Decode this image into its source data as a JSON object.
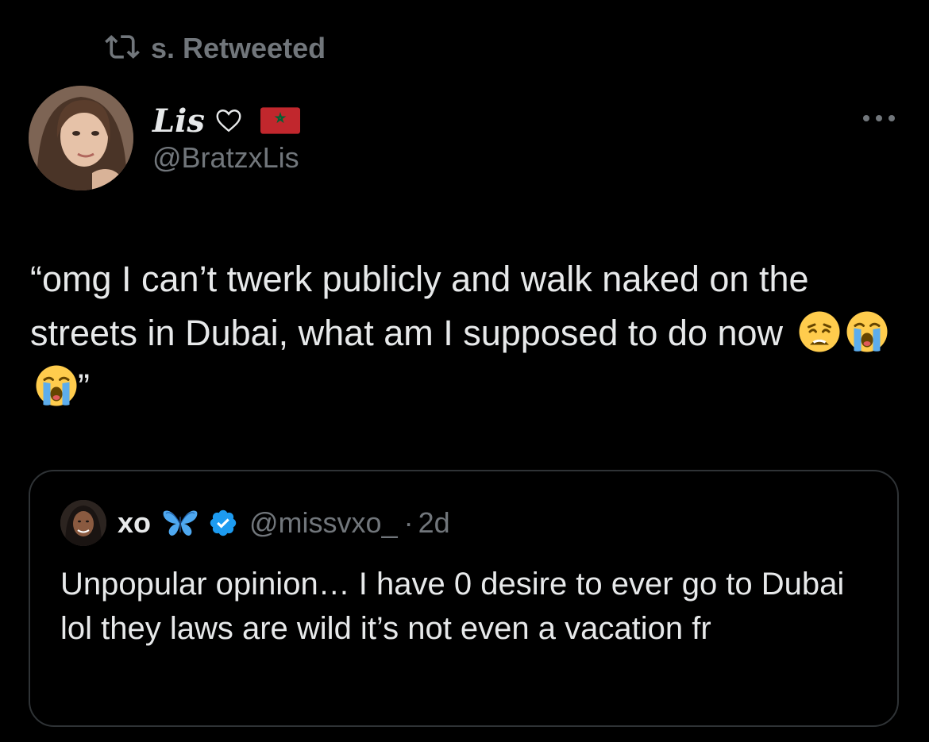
{
  "retweet": {
    "label": "s. Retweeted",
    "icon": "retweet-icon"
  },
  "author": {
    "display_name": "Lis",
    "handle": "@BratzxLis",
    "name_icons": [
      "heart-outline-icon",
      "morocco-flag-icon"
    ],
    "avatar": "avatar"
  },
  "more_icon": "more-icon",
  "tweet": {
    "text": "“omg I can’t twerk publicly and walk naked on the streets in Dubai, what am I supposed to do now",
    "emojis": [
      "weary-face-emoji",
      "loudly-crying-face-emoji",
      "loudly-crying-face-emoji"
    ],
    "closing_quote": "”"
  },
  "quote": {
    "display_name": "xo",
    "handle": "@missvxo_",
    "separator": "·",
    "time": "2d",
    "text": "Unpopular opinion… I have 0 desire to ever go to Dubai lol they laws are wild it’s not even a vacation fr",
    "name_icons": [
      "blue-butterfly-icon",
      "verified-badge-icon"
    ]
  },
  "colors": {
    "background": "#000000",
    "primary_text": "#e7e9ea",
    "secondary_text": "#71767b",
    "border": "#2f3336",
    "verified_blue": "#1d9bf0",
    "flag_red": "#c1272d",
    "flag_green": "#006233"
  }
}
